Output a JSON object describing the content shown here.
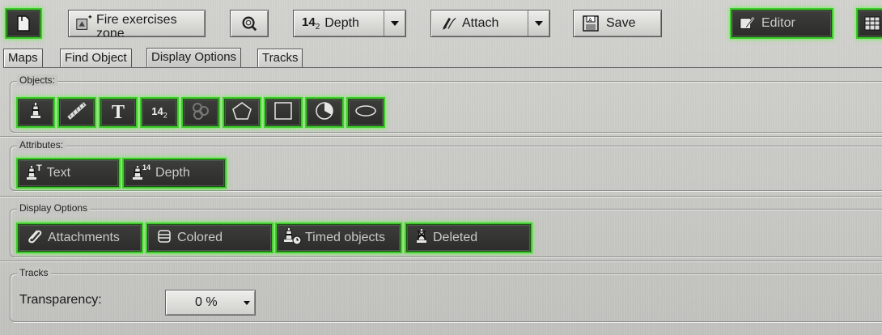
{
  "toolbar": {
    "new_icon": "document-icon",
    "fire_zone_label": "Fire exercises zone",
    "search_icon": "magnifier-icon",
    "depth_value": "14",
    "depth_sub": "2",
    "depth_label": "Depth",
    "attach_label": "Attach",
    "save_label": "Save",
    "editor_label": "Editor"
  },
  "tabs": [
    {
      "label": "Maps"
    },
    {
      "label": "Find Object"
    },
    {
      "label": "Display Options"
    },
    {
      "label": "Tracks"
    }
  ],
  "active_tab": "Display Options",
  "objects_group": {
    "label": "Objects:",
    "buttons": [
      {
        "icon": "buoy-icon"
      },
      {
        "icon": "hatched-line-icon"
      },
      {
        "icon": "text-t-icon",
        "glyph": "T"
      },
      {
        "icon": "depth-number-icon",
        "glyph": "14",
        "sub": "2"
      },
      {
        "icon": "circles-icon"
      },
      {
        "icon": "pentagon-icon"
      },
      {
        "icon": "square-icon"
      },
      {
        "icon": "pie-sector-icon"
      },
      {
        "icon": "ellipse-icon"
      }
    ]
  },
  "attributes_group": {
    "label": "Attributes:",
    "buttons": [
      {
        "label": "Text",
        "icon": "buoy-text-icon",
        "sup": "T"
      },
      {
        "label": "Depth",
        "icon": "buoy-depth-icon",
        "sup": "14"
      }
    ]
  },
  "display_options_group": {
    "label": "Display Options",
    "buttons": [
      {
        "label": "Attachments",
        "icon": "paperclip-icon"
      },
      {
        "label": "Colored",
        "icon": "color-layers-icon"
      },
      {
        "label": "Timed objects",
        "icon": "buoy-clock-icon"
      },
      {
        "label": "Deleted",
        "icon": "buoy-deleted-icon"
      }
    ]
  },
  "tracks_group": {
    "label": "Tracks",
    "transparency_label": "Transparency:",
    "transparency_value": "0 %"
  },
  "colors": {
    "active_glow": "#3ecb2b",
    "button_dark": "#3a3a38",
    "panel": "#c4c4c0"
  }
}
